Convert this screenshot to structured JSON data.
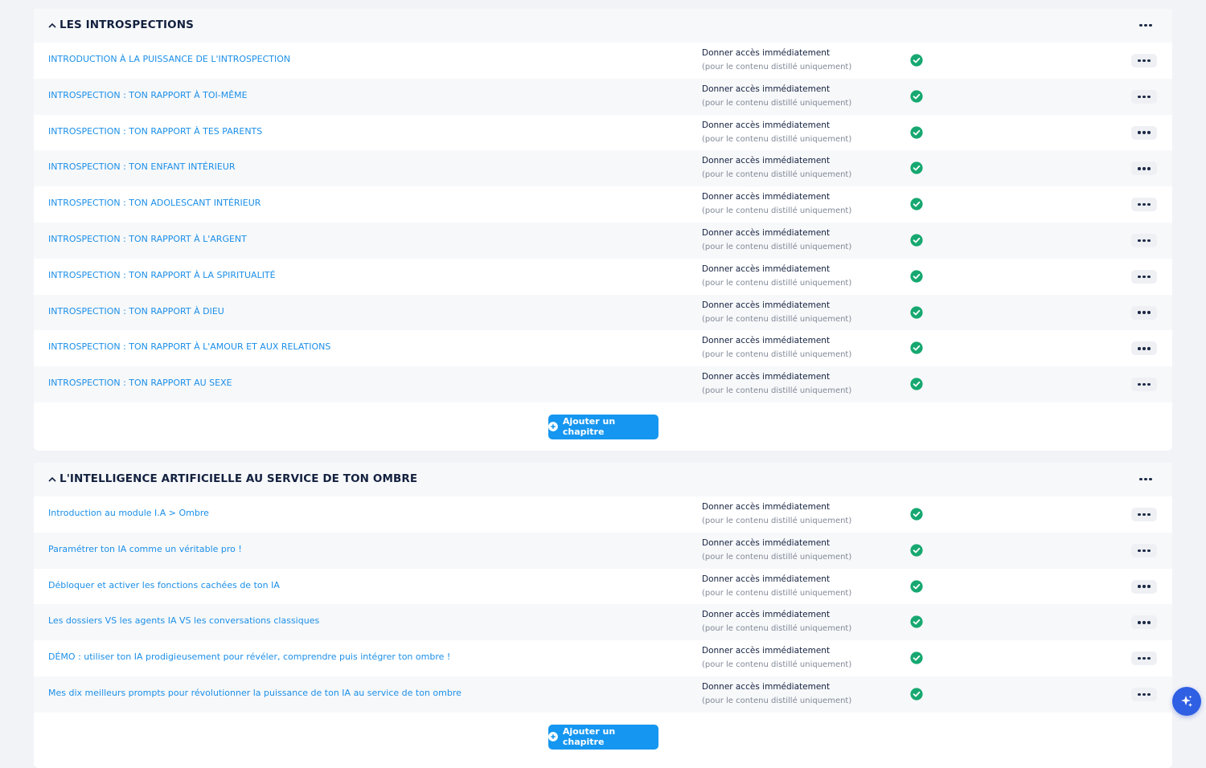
{
  "colors": {
    "link": "#1b8fe8",
    "accent_button": "#1596f0",
    "check": "#16a870",
    "title": "#13213f"
  },
  "sections": [
    {
      "title": "LES INTROSPECTIONS",
      "add_label": "Ajouter un chapitre",
      "chapters": [
        {
          "title": "INTRODUCTION À LA PUISSANCE DE L'INTROSPECTION",
          "access": "Donner accès immédiatement",
          "access_note": "(pour le contenu distillé uniquement)"
        },
        {
          "title": "INTROSPECTION : TON RAPPORT À TOI-MÊME",
          "access": "Donner accès immédiatement",
          "access_note": "(pour le contenu distillé uniquement)"
        },
        {
          "title": "INTROSPECTION : TON RAPPORT À TES PARENTS",
          "access": "Donner accès immédiatement",
          "access_note": "(pour le contenu distillé uniquement)"
        },
        {
          "title": "INTROSPECTION : TON ENFANT INTÉRIEUR",
          "access": "Donner accès immédiatement",
          "access_note": "(pour le contenu distillé uniquement)"
        },
        {
          "title": "INTROSPECTION : TON ADOLESCANT INTÉRIEUR",
          "access": "Donner accès immédiatement",
          "access_note": "(pour le contenu distillé uniquement)"
        },
        {
          "title": "INTROSPECTION : TON RAPPORT À L'ARGENT",
          "access": "Donner accès immédiatement",
          "access_note": "(pour le contenu distillé uniquement)"
        },
        {
          "title": "INTROSPECTION : TON RAPPORT À LA SPIRITUALITÉ",
          "access": "Donner accès immédiatement",
          "access_note": "(pour le contenu distillé uniquement)"
        },
        {
          "title": "INTROSPECTION : TON RAPPORT À DIEU",
          "access": "Donner accès immédiatement",
          "access_note": "(pour le contenu distillé uniquement)"
        },
        {
          "title": "INTROSPECTION : TON RAPPORT À L'AMOUR ET AUX RELATIONS",
          "access": "Donner accès immédiatement",
          "access_note": "(pour le contenu distillé uniquement)"
        },
        {
          "title": "INTROSPECTION : TON RAPPORT AU SEXE",
          "access": "Donner accès immédiatement",
          "access_note": "(pour le contenu distillé uniquement)"
        }
      ]
    },
    {
      "title": "L'INTELLIGENCE ARTIFICIELLE AU SERVICE DE TON OMBRE",
      "add_label": "Ajouter un chapitre",
      "chapters": [
        {
          "title": "Introduction au module I.A > Ombre",
          "access": "Donner accès immédiatement",
          "access_note": "(pour le contenu distillé uniquement)"
        },
        {
          "title": "Paramétrer ton IA comme un véritable pro !",
          "access": "Donner accès immédiatement",
          "access_note": "(pour le contenu distillé uniquement)"
        },
        {
          "title": "Débloquer et activer les fonctions cachées de ton IA",
          "access": "Donner accès immédiatement",
          "access_note": "(pour le contenu distillé uniquement)"
        },
        {
          "title": "Les dossiers VS les agents IA VS les conversations classiques",
          "access": "Donner accès immédiatement",
          "access_note": "(pour le contenu distillé uniquement)"
        },
        {
          "title": "DÉMO : utiliser ton IA prodigieusement pour révéler, comprendre puis intégrer ton ombre !",
          "access": "Donner accès immédiatement",
          "access_note": "(pour le contenu distillé uniquement)"
        },
        {
          "title": "Mes dix meilleurs prompts pour révolutionner la puissance de ton IA au service de ton ombre",
          "access": "Donner accès immédiatement",
          "access_note": "(pour le contenu distillé uniquement)"
        }
      ]
    }
  ]
}
